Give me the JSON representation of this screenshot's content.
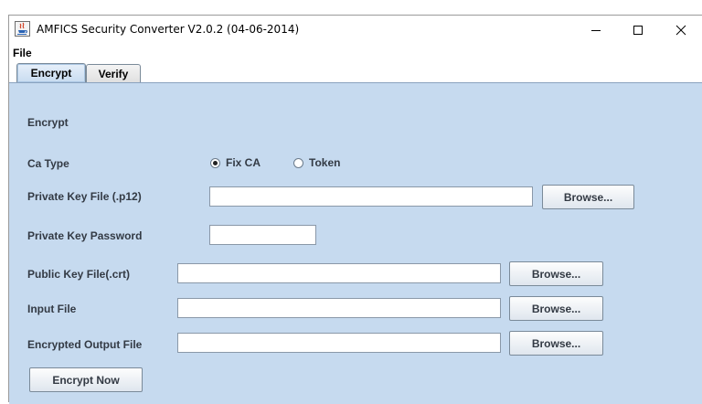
{
  "window": {
    "title": "AMFICS Security Converter V2.0.2 (04-06-2014)",
    "icons": {
      "app": "java-app-icon",
      "minimize": "minimize-icon",
      "maximize": "maximize-icon",
      "close": "close-icon"
    }
  },
  "menu": {
    "file": "File"
  },
  "tabs": [
    {
      "label": "Encrypt",
      "active": true
    },
    {
      "label": "Verify",
      "active": false
    }
  ],
  "encrypt": {
    "section_title": "Encrypt",
    "ca_type_label": "Ca Type",
    "ca_options": [
      {
        "label": "Fix CA",
        "selected": true
      },
      {
        "label": "Token",
        "selected": false
      }
    ],
    "private_key_file_label": "Private Key File (.p12)",
    "private_key_file_value": "",
    "private_key_password_label": "Private Key Password",
    "private_key_password_value": "",
    "public_key_file_label": "Public Key File(.crt)",
    "public_key_file_value": "",
    "input_file_label": "Input File",
    "input_file_value": "",
    "encrypted_output_file_label": "Encrypted Output File",
    "encrypted_output_file_value": "",
    "browse_label": "Browse...",
    "encrypt_now_label": "Encrypt Now"
  },
  "colors": {
    "panel_bg": "#c6daef",
    "label_text": "#333a44"
  }
}
